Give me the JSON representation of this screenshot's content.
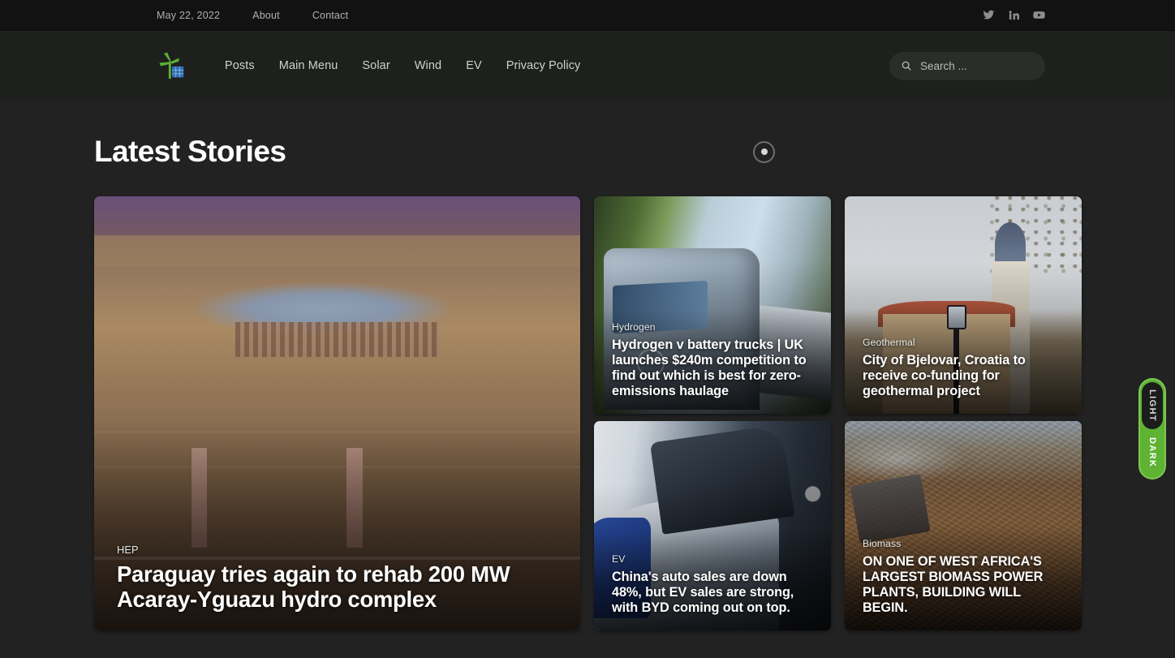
{
  "topbar": {
    "date": "May 22, 2022",
    "links": [
      {
        "label": "About"
      },
      {
        "label": "Contact"
      }
    ],
    "social": [
      {
        "name": "twitter-icon"
      },
      {
        "name": "linkedin-icon"
      },
      {
        "name": "youtube-icon"
      }
    ]
  },
  "header": {
    "logo_name": "site-logo-wind-turbine-solar-panel",
    "nav": [
      {
        "label": "Posts"
      },
      {
        "label": "Main Menu"
      },
      {
        "label": "Solar"
      },
      {
        "label": "Wind"
      },
      {
        "label": "EV"
      },
      {
        "label": "Privacy Policy"
      }
    ],
    "search": {
      "icon": "search-icon",
      "placeholder": "Search ...",
      "value": ""
    }
  },
  "main": {
    "section_title": "Latest Stories",
    "carousel_indicator": "carousel-dot"
  },
  "cards": [
    {
      "id": "hero",
      "category": "HEP",
      "title": "Paraguay tries again to rehab 200 MW Acaray-Yguazu hydro complex",
      "image_desc": "aerial-photo-hydro-dam-reservoir"
    },
    {
      "id": "hydrogen",
      "category": "Hydrogen",
      "title": "Hydrogen v battery trucks | UK launches $240m competition to find out which is best for zero-emissions haulage",
      "image_desc": "silver-semi-truck-motion-blur"
    },
    {
      "id": "geothermal",
      "category": "Geothermal",
      "title": "City of Bjelovar, Croatia to receive co-funding for geothermal project",
      "image_desc": "church-with-bell-tower"
    },
    {
      "id": "ev",
      "category": "EV",
      "title": "China's auto sales are down 48%, but EV sales are strong, with BYD coming out on top.",
      "image_desc": "blue-electric-car-at-auto-show"
    },
    {
      "id": "biomass",
      "category": "Biomass",
      "title": "ON ONE OF WEST AFRICA'S LARGEST BIOMASS POWER PLANTS, BUILDING WILL BEGIN.",
      "image_desc": "pile-of-wood-chips-biomass"
    }
  ],
  "theme_toggle": {
    "light_label": "LIGHT",
    "dark_label": "DARK",
    "active": "DARK",
    "accent_color": "#5eb332"
  },
  "colors": {
    "page_bg": "#222222",
    "topbar_bg": "#121212",
    "header_bg": "#1e201d",
    "accent_green": "#5eb332",
    "text_primary": "#ffffff",
    "text_muted": "#aeb0ae"
  }
}
